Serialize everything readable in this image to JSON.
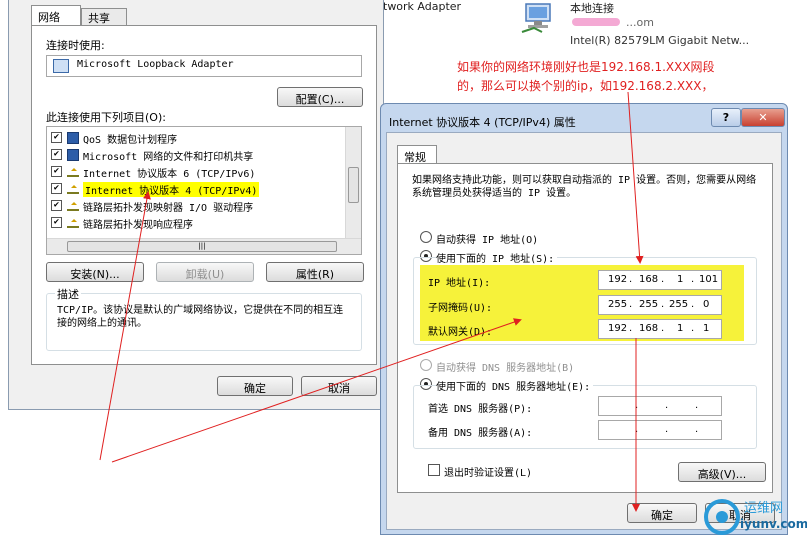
{
  "background": {
    "adapter_partial": "twork Adapter",
    "connection_name": "本地连接",
    "connection_sub": "...om",
    "adapter_name": "Intel(R) 82579LM Gigabit Netw..."
  },
  "annotation": {
    "line1": "如果你的网络环境刚好也是192.168.1.XXX网段",
    "line2": "的，那么可以换个别的ip，如192.168.2.XXX，",
    "color": "#e02020"
  },
  "left_dialog": {
    "tabs": [
      "网络",
      "共享"
    ],
    "connect_using_label": "连接时使用:",
    "adapter": "Microsoft Loopback Adapter",
    "configure_button": "配置(C)...",
    "items_label": "此连接使用下列项目(O):",
    "items": [
      {
        "label": "QoS 数据包计划程序",
        "checked": "✔",
        "icon": "net"
      },
      {
        "label": "Microsoft 网络的文件和打印机共享",
        "checked": "✔",
        "icon": "net"
      },
      {
        "label": "Internet 协议版本 6 (TCP/IPv6)",
        "checked": "✔",
        "icon": "proto"
      },
      {
        "label": "Internet 协议版本 4 (TCP/IPv4)",
        "checked": "✔",
        "icon": "proto"
      },
      {
        "label": "链路层拓扑发现映射器 I/O 驱动程序",
        "checked": "✔",
        "icon": "proto"
      },
      {
        "label": "链路层拓扑发现响应程序",
        "checked": "✔",
        "icon": "proto"
      }
    ],
    "install_button": "安装(N)...",
    "uninstall_button": "卸载(U)",
    "properties_button": "属性(R)",
    "description_title": "描述",
    "description_text": "TCP/IP。该协议是默认的广域网络协议，它提供在不同的相互连接的网络上的通讯。",
    "ok_button": "确定",
    "cancel_button": "取消"
  },
  "ipv4_dialog": {
    "title": "Internet 协议版本 4 (TCP/IPv4) 属性",
    "help_button": "?",
    "close_button": "✕",
    "tab": "常规",
    "intro": "如果网络支持此功能，则可以获取自动指派的 IP 设置。否则，您需要从网络系统管理员处获得适当的 IP 设置。",
    "auto_ip_label": "自动获得 IP 地址(O)",
    "manual_ip_label": "使用下面的 IP 地址(S):",
    "ip_label": "IP 地址(I):",
    "ip_value": [
      "192",
      "168",
      "1",
      "101"
    ],
    "mask_label": "子网掩码(U):",
    "mask_value": [
      "255",
      "255",
      "255",
      "0"
    ],
    "gateway_label": "默认网关(D):",
    "gateway_value": [
      "192",
      "168",
      "1",
      "1"
    ],
    "auto_dns_label": "自动获得 DNS 服务器地址(B)",
    "manual_dns_label": "使用下面的 DNS 服务器地址(E):",
    "preferred_dns_label": "首选 DNS 服务器(P):",
    "alternate_dns_label": "备用 DNS 服务器(A):",
    "validate_label": "退出时验证设置(L)",
    "advanced_button": "高级(V)...",
    "ok_button": "确定",
    "cancel_button": "取消"
  },
  "watermark": {
    "line1": "运维网",
    "line2": "iyunv.com"
  }
}
